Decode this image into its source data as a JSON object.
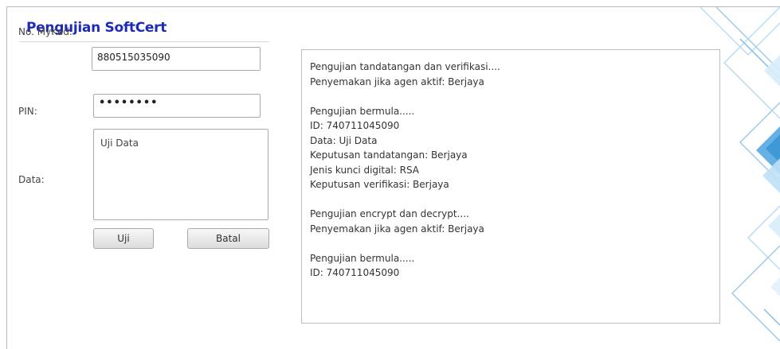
{
  "title": "Pengujian SoftCert",
  "form": {
    "mykad_label": "No. MyKad:",
    "mykad_value": "880515035090",
    "pin_label": "PIN:",
    "pin_value": "••••••••",
    "data_label": "Data:",
    "data_value": "Uji Data"
  },
  "buttons": {
    "uji": "Uji",
    "batal": "Batal"
  },
  "output_lines": [
    "Pengujian tandatangan dan verifikasi....",
    "Penyemakan jika agen aktif: Berjaya",
    "",
    "Pengujian bermula.....",
    "ID: 740711045090",
    "Data: Uji Data",
    "Keputusan tandatangan: Berjaya",
    "Jenis kunci digital: RSA",
    "Keputusan verifikasi: Berjaya",
    "",
    "Pengujian encrypt dan decrypt....",
    "Penyemakan jika agen aktif: Berjaya",
    "",
    "Pengujian bermula.....",
    "ID: 740711045090"
  ],
  "colors": {
    "title": "#1d2bb8",
    "decor_blue": "#4aa3df",
    "decor_light": "#bfe0f5"
  }
}
